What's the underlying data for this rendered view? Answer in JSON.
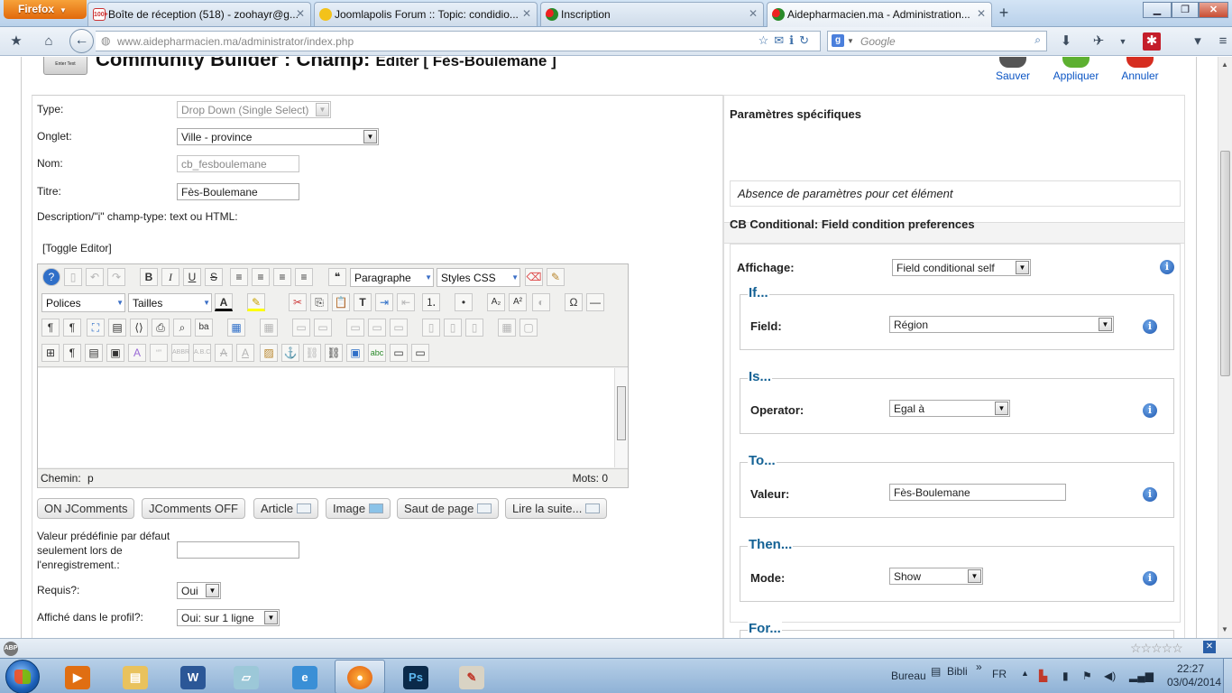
{
  "browser": {
    "menu_button": "Firefox",
    "tabs": [
      {
        "title": "Boîte de réception (518) - zoohayr@g...",
        "favicon": "gmail-icon",
        "favicon_text": "100+"
      },
      {
        "title": "Joomlapolis Forum :: Topic: condidio...",
        "favicon": "joomlapolis-icon",
        "favicon_text": ""
      },
      {
        "title": "Inscription",
        "favicon": "aidepharmacien-icon",
        "favicon_text": ""
      },
      {
        "title": "Aidepharmacien.ma - Administration...",
        "favicon": "aidepharmacien-icon",
        "favicon_text": ""
      }
    ],
    "url_host": "www.aidepharmacien.ma",
    "url_path": "/administrator/index.php",
    "search_engine": "g",
    "search_placeholder": "Google"
  },
  "header": {
    "title": "Community Builder : Champ:",
    "subtitle": "Editer [ Fès-Boulemane ]",
    "icon_label": "Enter Text",
    "actions": {
      "save": "Sauver",
      "apply": "Appliquer",
      "cancel": "Annuler"
    }
  },
  "form": {
    "type_label": "Type:",
    "type_value": "Drop Down (Single Select)",
    "tab_label": "Onglet:",
    "tab_value": "Ville - province",
    "name_label": "Nom:",
    "name_value": "cb_fesboulemane",
    "title_label": "Titre:",
    "title_value": "Fès-Boulemane",
    "description_label": "Description/\"i\" champ-type: text ou HTML:",
    "toggle_editor": "[Toggle Editor]",
    "editor": {
      "format_select": "Paragraphe",
      "styles_select": "Styles CSS",
      "fonts_select": "Polices",
      "sizes_select": "Tailles",
      "path_label": "Chemin:",
      "path_value": "p",
      "words_label": "Mots: 0"
    },
    "plugin_buttons": [
      "ON JComments",
      "JComments OFF",
      "Article",
      "Image",
      "Saut de page",
      "Lire la suite..."
    ],
    "default_label": "Valeur prédéfinie par défaut seulement lors de l'enregistrement.:",
    "default_value": "",
    "required_label": "Requis?:",
    "required_value": "Oui",
    "profile_label": "Affiché dans le profil?:",
    "profile_value": "Oui: sur 1 ligne"
  },
  "right": {
    "specific_title": "Paramètres spécifiques",
    "no_params": "Absence de paramètres pour cet élément",
    "cond_title": "CB Conditional: Field condition preferences",
    "display_label": "Affichage:",
    "display_value": "Field conditional self",
    "if_legend": "If...",
    "field_label": "Field:",
    "field_value": "Région",
    "is_legend": "Is...",
    "operator_label": "Operator:",
    "operator_value": "Egal à",
    "to_legend": "To...",
    "value_label": "Valeur:",
    "value_value": "Fès-Boulemane",
    "then_legend": "Then...",
    "mode_label": "Mode:",
    "mode_value": "Show",
    "for_legend": "For..."
  },
  "taskbar": {
    "tray_desktop": "Bureau",
    "tray_bibli": "Bibli",
    "language": "FR",
    "time": "22:27",
    "date": "03/04/2014"
  }
}
